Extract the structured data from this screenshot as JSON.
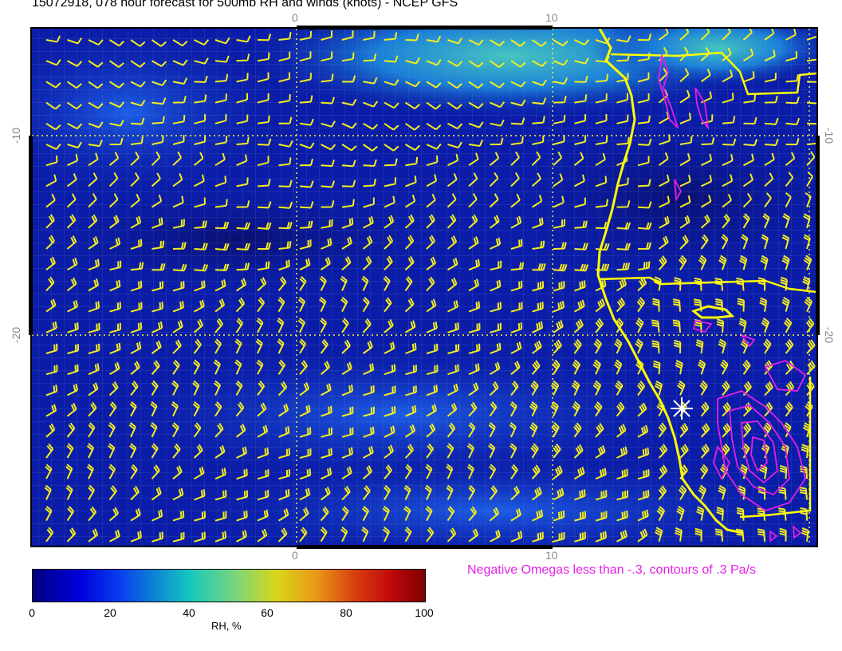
{
  "title": "15072918, 078 hour forecast for 500mb RH and winds (knots) - NCEP GFS",
  "omega_note": "Negative Omegas less than -.3, contours of .3 Pa/s",
  "axis_labels": {
    "top": [
      "0",
      "10"
    ],
    "bottom": [
      "0",
      "10"
    ],
    "left": [
      "-10",
      "-20"
    ],
    "right": [
      "-10",
      "-20"
    ]
  },
  "colorbar": {
    "labels": [
      "0",
      "20",
      "40",
      "60",
      "80",
      "100"
    ],
    "title": "RH, %",
    "colors": [
      "#00007f",
      "#0000dd",
      "#0a3cf0",
      "#0d8ad0",
      "#15c7c0",
      "#7cd67a",
      "#d8d71a",
      "#e89a14",
      "#d8400e",
      "#c20a0a",
      "#7f0000"
    ]
  },
  "colors": {
    "wind_barbs": "#f5ee1c",
    "coastline": "#ffff00",
    "omega_contours": "#e61ee6",
    "background_field": "#0b1da8"
  },
  "icons": [
    "wind-barb-icon",
    "location-star-icon"
  ]
}
